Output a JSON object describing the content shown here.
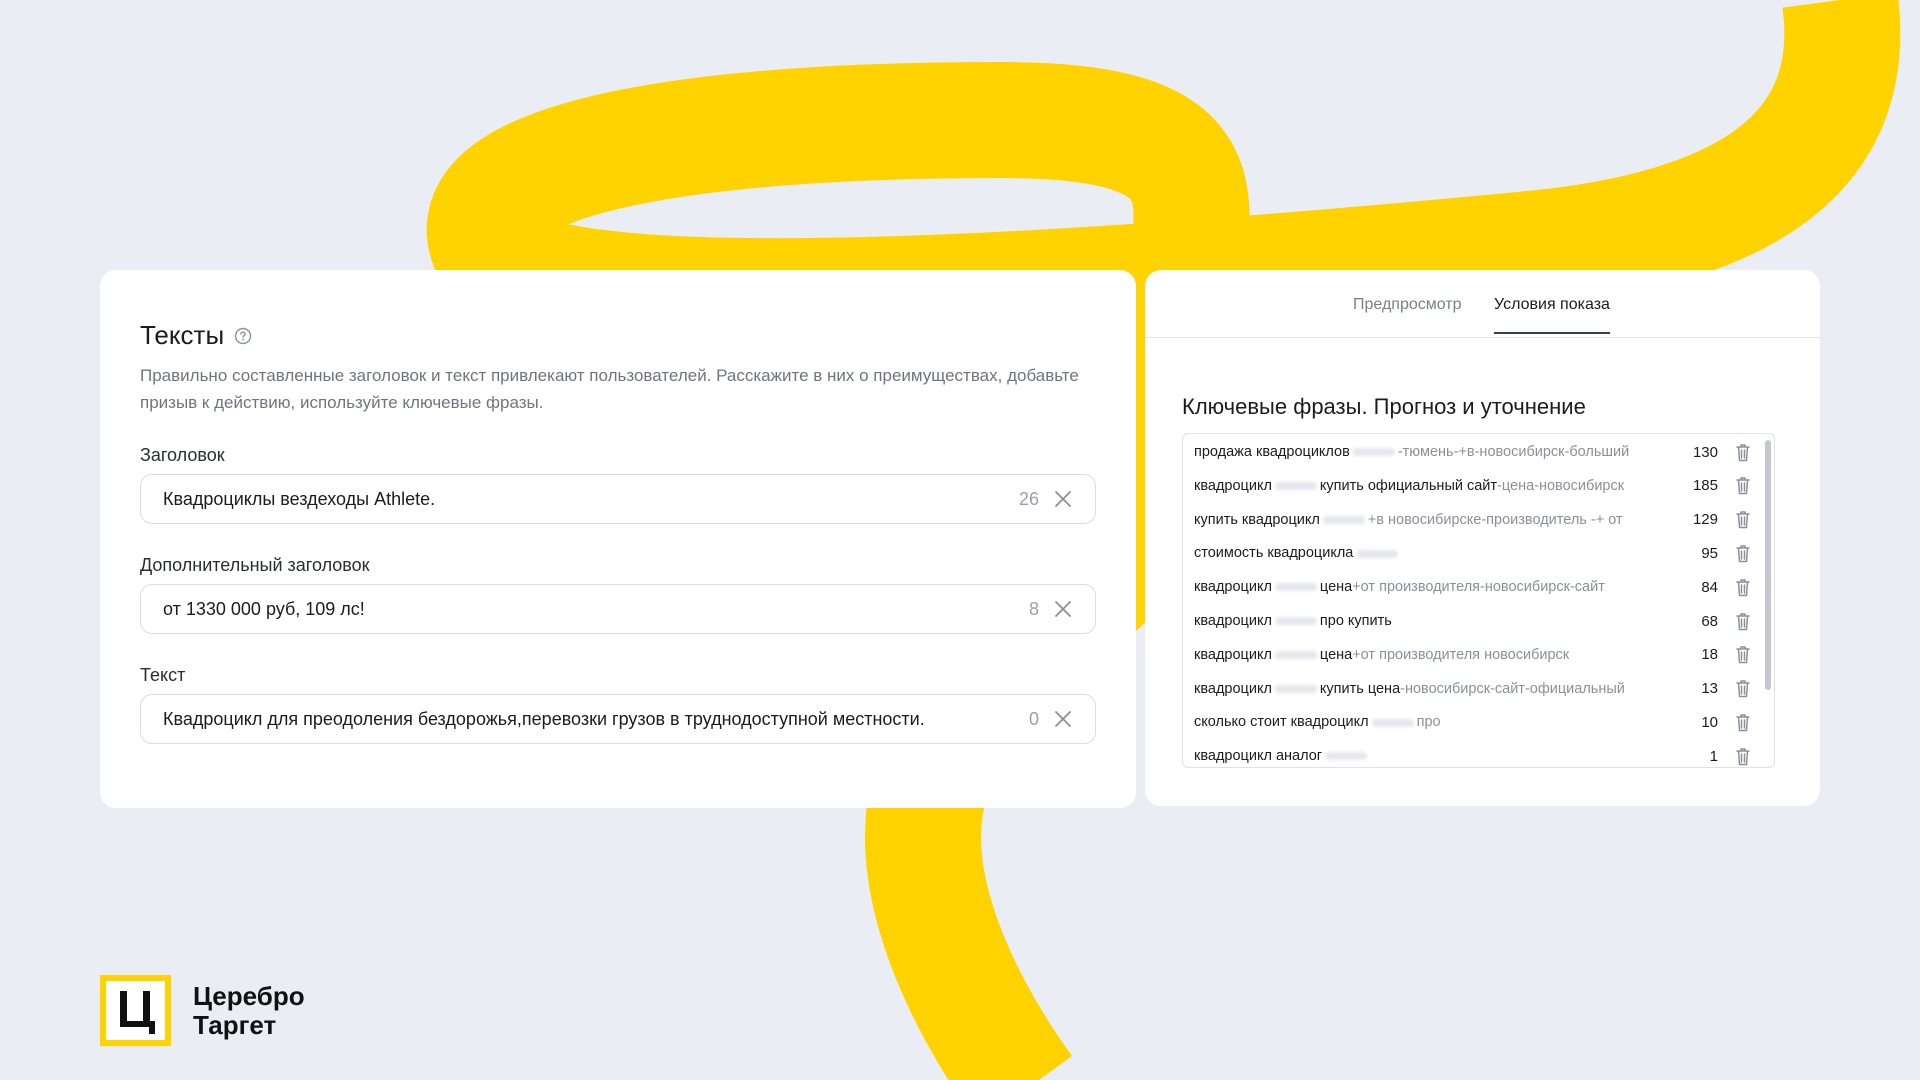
{
  "colors": {
    "accent": "#ffd200",
    "background": "#eaedf4",
    "card": "#ffffff"
  },
  "texts": {
    "title": "Тексты",
    "help_icon": "question-circle-icon",
    "description": "Правильно составленные заголовок и текст привлекают пользователей. Расскажите в них о преимуществах, добавьте призыв к действию, используйте ключевые фразы.",
    "fields": [
      {
        "label": "Заголовок",
        "value": "Квадроциклы вездеходы Athlete.",
        "count": "26"
      },
      {
        "label": "Дополнительный заголовок",
        "value": "от 1330 000 руб, 109 лс!",
        "count": "8"
      },
      {
        "label": "Текст",
        "value": "Квадроцикл для преодоления бездорожья,перевозки грузов в труднодоступной местности.",
        "count": "0"
      }
    ]
  },
  "keywords": {
    "tabs": [
      {
        "label": "Предпросмотр",
        "active": false
      },
      {
        "label": "Условия показа",
        "active": true
      }
    ],
    "title": "Ключевые фразы. Прогноз и уточнение",
    "rows": [
      {
        "phrase": "продажа квадроциклов",
        "extra": "-тюмень-+в-новосибирск-больший",
        "count": "130"
      },
      {
        "phrase": "квадроцикл",
        "mid": "купить официальный сайт",
        "extra": "-цена-новосибирск",
        "count": "185"
      },
      {
        "phrase": "купить квадроцикл",
        "extra": "+в новосибирске-производитель -+ от",
        "count": "129"
      },
      {
        "phrase": "стоимость квадроцикла",
        "extra": "",
        "count": "95"
      },
      {
        "phrase": "квадроцикл",
        "mid": "цена",
        "extra": "+от производителя-новосибирск-сайт",
        "count": "84"
      },
      {
        "phrase": "квадроцикл",
        "mid": "про купить",
        "extra": "",
        "count": "68"
      },
      {
        "phrase": "квадроцикл",
        "mid": "цена",
        "extra": "+от производителя новосибирск",
        "count": "18"
      },
      {
        "phrase": "квадроцикл",
        "mid": "купить цена",
        "extra": "-новосибирск-сайт-официальный",
        "count": "13"
      },
      {
        "phrase": "сколько стоит квадроцикл",
        "extra": "про",
        "count": "10"
      },
      {
        "phrase": "квадроцикл аналог",
        "extra": "",
        "count": "1"
      }
    ]
  },
  "brand": {
    "line1": "Церебро",
    "line2": "Таргет",
    "mark": "Ц"
  }
}
